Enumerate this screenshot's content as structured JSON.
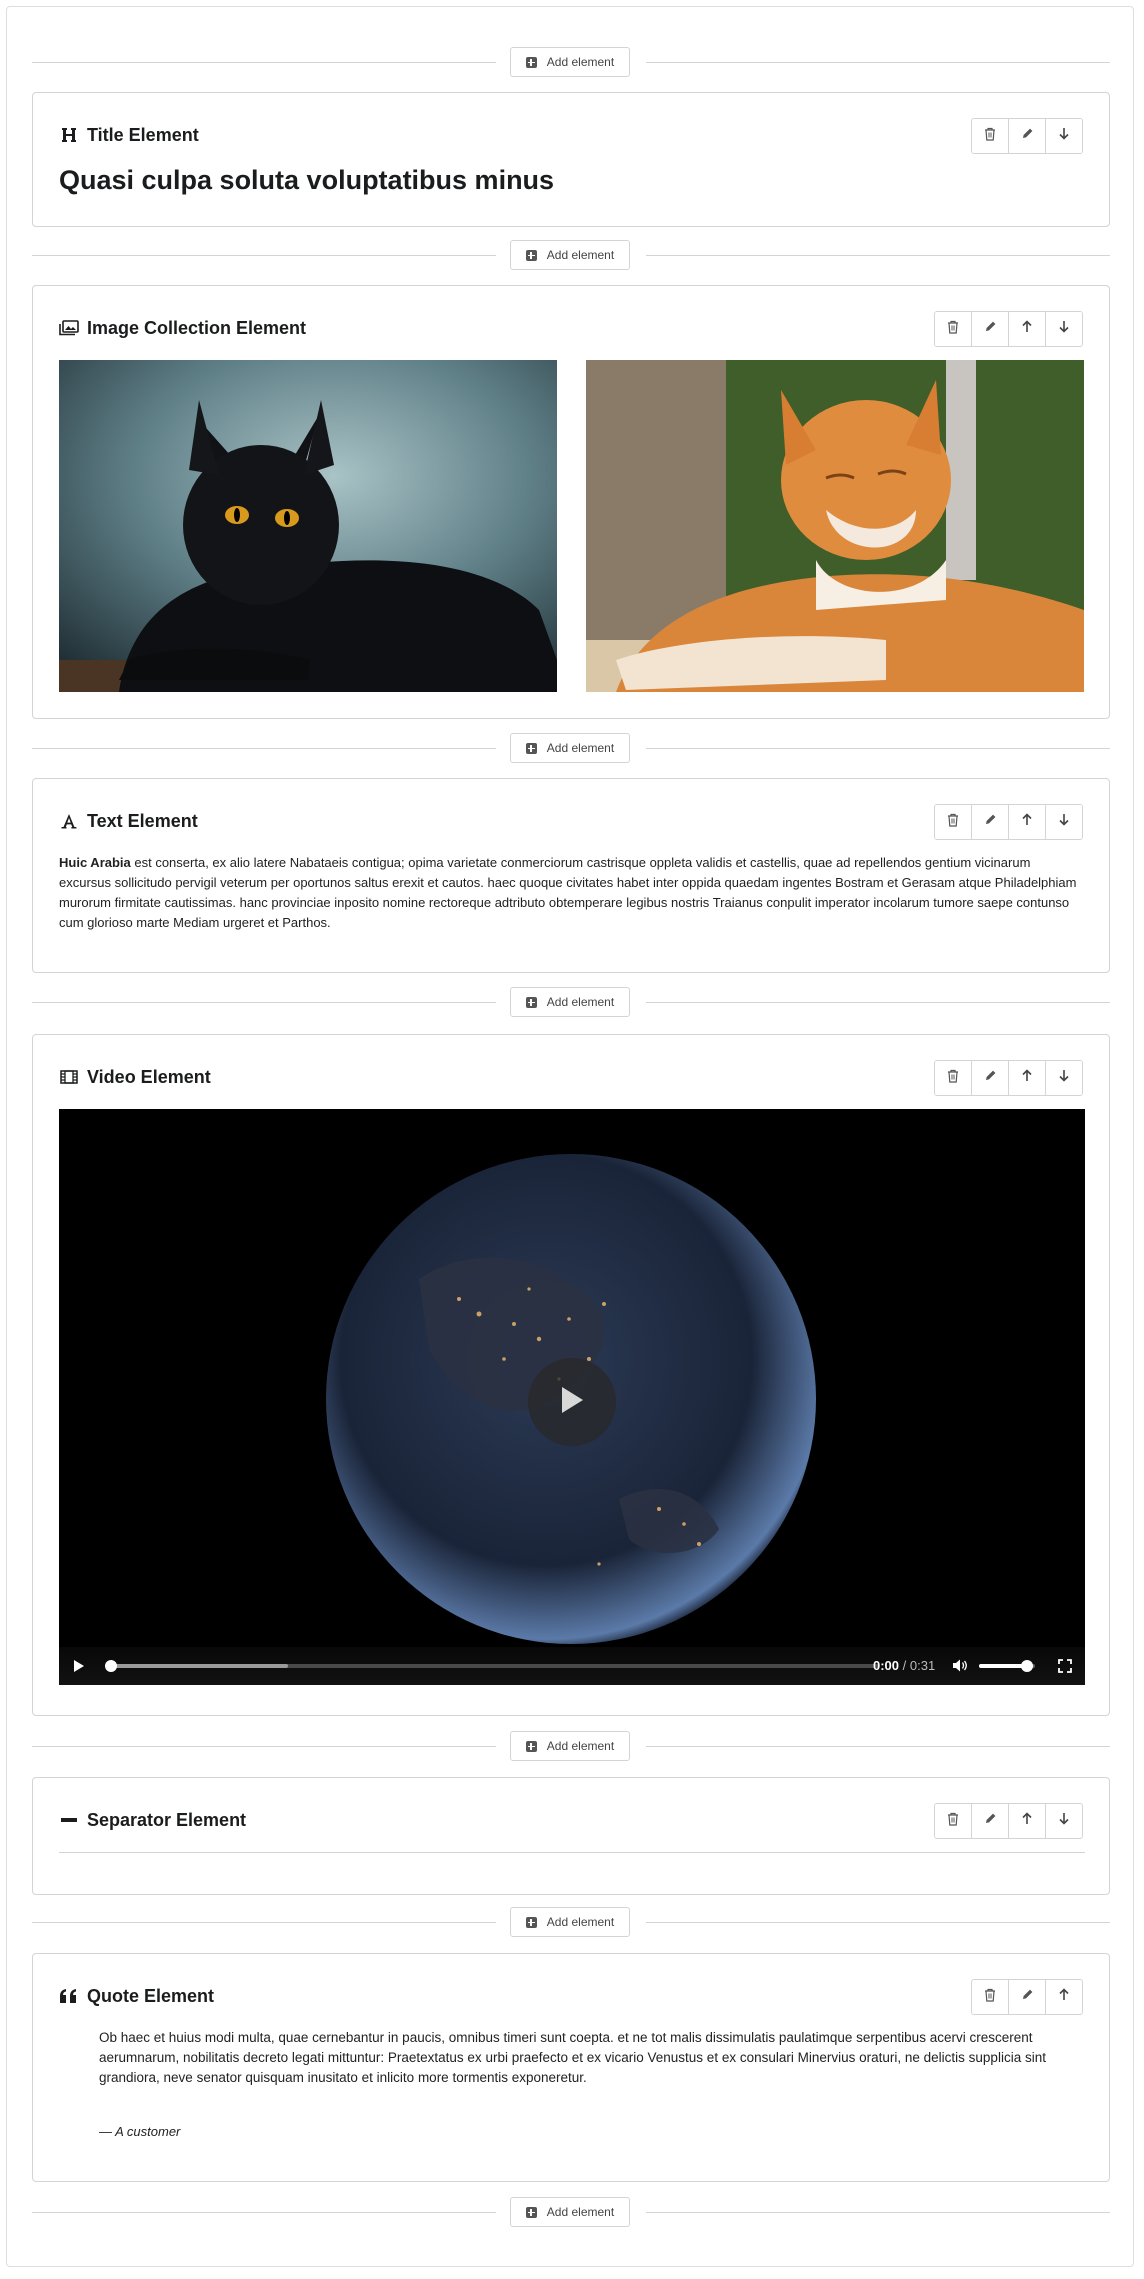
{
  "add_label": "Add element",
  "title_el": {
    "header": "Title Element",
    "content": "Quasi culpa soluta voluptatibus minus"
  },
  "image_el": {
    "header": "Image Collection Element"
  },
  "text_el": {
    "header": "Text Element",
    "bold": "Huic Arabia",
    "body": " est conserta, ex alio latere Nabataeis contigua; opima varietate conmerciorum castrisque oppleta validis et castellis, quae ad repellendos gentium vicinarum excursus sollicitudo pervigil veterum per oportunos saltus erexit et cautos. haec quoque civitates habet inter oppida quaedam ingentes Bostram et Gerasam atque Philadelphiam murorum firmitate cautissimas. hanc provinciae inposito nomine rectoreque adtributo obtemperare legibus nostris Traianus conpulit imperator incolarum tumore saepe contunso cum glorioso marte Mediam urgeret et Parthos."
  },
  "video_el": {
    "header": "Video Element",
    "time_current": "0:00",
    "time_sep": " / ",
    "time_total": "0:31",
    "volume": 0.85,
    "buffered": 0.23
  },
  "separator_el": {
    "header": "Separator Element"
  },
  "quote_el": {
    "header": "Quote Element",
    "text": "Ob haec et huius modi multa, quae cernebantur in paucis, omnibus timeri sunt coepta. et ne tot malis dissimulatis paulatimque serpentibus acervi crescerent aerumnarum, nobilitatis decreto legati mittuntur: Praetextatus ex urbi praefecto et ex vicario Venustus et ex consulari Minervius oraturi, ne delictis supplicia sint grandiora, neve senator quisquam inusitato et inlicito more tormentis exponeretur.",
    "cite": "— A customer"
  }
}
